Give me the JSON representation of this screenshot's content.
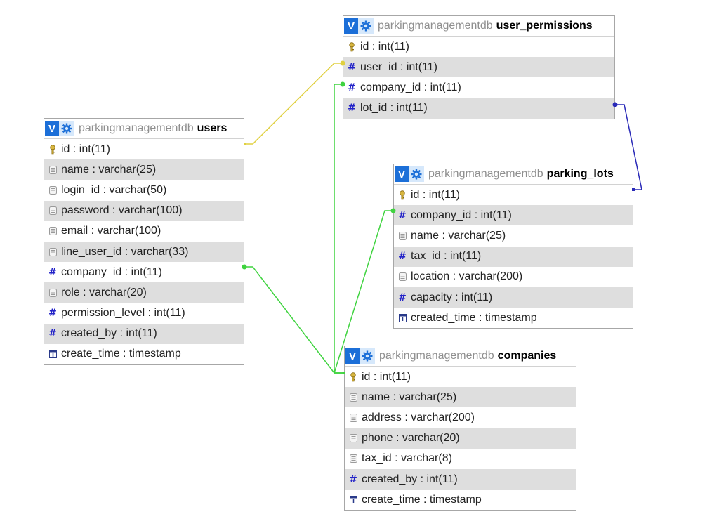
{
  "diagram": {
    "tables": [
      {
        "key": "users",
        "db": "parkingmanagementdb",
        "name": "users",
        "columns": [
          {
            "label": "id : int(11)",
            "icon": "key-icon"
          },
          {
            "label": "name : varchar(25)",
            "icon": "text-column-icon"
          },
          {
            "label": "login_id : varchar(50)",
            "icon": "text-column-icon"
          },
          {
            "label": "password : varchar(100)",
            "icon": "text-column-icon"
          },
          {
            "label": "email : varchar(100)",
            "icon": "text-column-icon"
          },
          {
            "label": "line_user_id : varchar(33)",
            "icon": "text-column-icon"
          },
          {
            "label": "company_id : int(11)",
            "icon": "numeric-column-icon"
          },
          {
            "label": "role : varchar(20)",
            "icon": "text-column-icon"
          },
          {
            "label": "permission_level : int(11)",
            "icon": "numeric-column-icon"
          },
          {
            "label": "created_by : int(11)",
            "icon": "numeric-column-icon"
          },
          {
            "label": "create_time : timestamp",
            "icon": "timestamp-column-icon"
          }
        ]
      },
      {
        "key": "user_permissions",
        "db": "parkingmanagementdb",
        "name": "user_permissions",
        "columns": [
          {
            "label": "id : int(11)",
            "icon": "key-icon"
          },
          {
            "label": "user_id : int(11)",
            "icon": "numeric-column-icon"
          },
          {
            "label": "company_id : int(11)",
            "icon": "numeric-column-icon"
          },
          {
            "label": "lot_id : int(11)",
            "icon": "numeric-column-icon"
          }
        ]
      },
      {
        "key": "parking_lots",
        "db": "parkingmanagementdb",
        "name": "parking_lots",
        "columns": [
          {
            "label": "id : int(11)",
            "icon": "key-icon"
          },
          {
            "label": "company_id : int(11)",
            "icon": "numeric-column-icon"
          },
          {
            "label": "name : varchar(25)",
            "icon": "text-column-icon"
          },
          {
            "label": "tax_id : int(11)",
            "icon": "numeric-column-icon"
          },
          {
            "label": "location : varchar(200)",
            "icon": "text-column-icon"
          },
          {
            "label": "capacity : int(11)",
            "icon": "numeric-column-icon"
          },
          {
            "label": "created_time : timestamp",
            "icon": "timestamp-column-icon"
          }
        ]
      },
      {
        "key": "companies",
        "db": "parkingmanagementdb",
        "name": "companies",
        "columns": [
          {
            "label": "id : int(11)",
            "icon": "key-icon"
          },
          {
            "label": "name : varchar(25)",
            "icon": "text-column-icon"
          },
          {
            "label": "address : varchar(200)",
            "icon": "text-column-icon"
          },
          {
            "label": "phone : varchar(20)",
            "icon": "text-column-icon"
          },
          {
            "label": "tax_id : varchar(8)",
            "icon": "text-column-icon"
          },
          {
            "label": "created_by : int(11)",
            "icon": "numeric-column-icon"
          },
          {
            "label": "create_time : timestamp",
            "icon": "timestamp-column-icon"
          }
        ]
      }
    ],
    "relations": [
      {
        "from": "user_permissions.user_id",
        "to": "users.id",
        "color": "#e0d040"
      },
      {
        "from": "user_permissions.company_id",
        "to": "companies.id",
        "color": "#3fd33f"
      },
      {
        "from": "user_permissions.lot_id",
        "to": "parking_lots.id",
        "color": "#2a2ab8"
      },
      {
        "from": "users.company_id",
        "to": "companies.id",
        "color": "#3fd33f"
      },
      {
        "from": "parking_lots.company_id",
        "to": "companies.id",
        "color": "#3fd33f"
      }
    ]
  },
  "colors": {
    "view-button": "#1c6fd8",
    "options-button": "#d6e8fb",
    "row-alt": "#dedede",
    "border": "#a7a7a7"
  }
}
